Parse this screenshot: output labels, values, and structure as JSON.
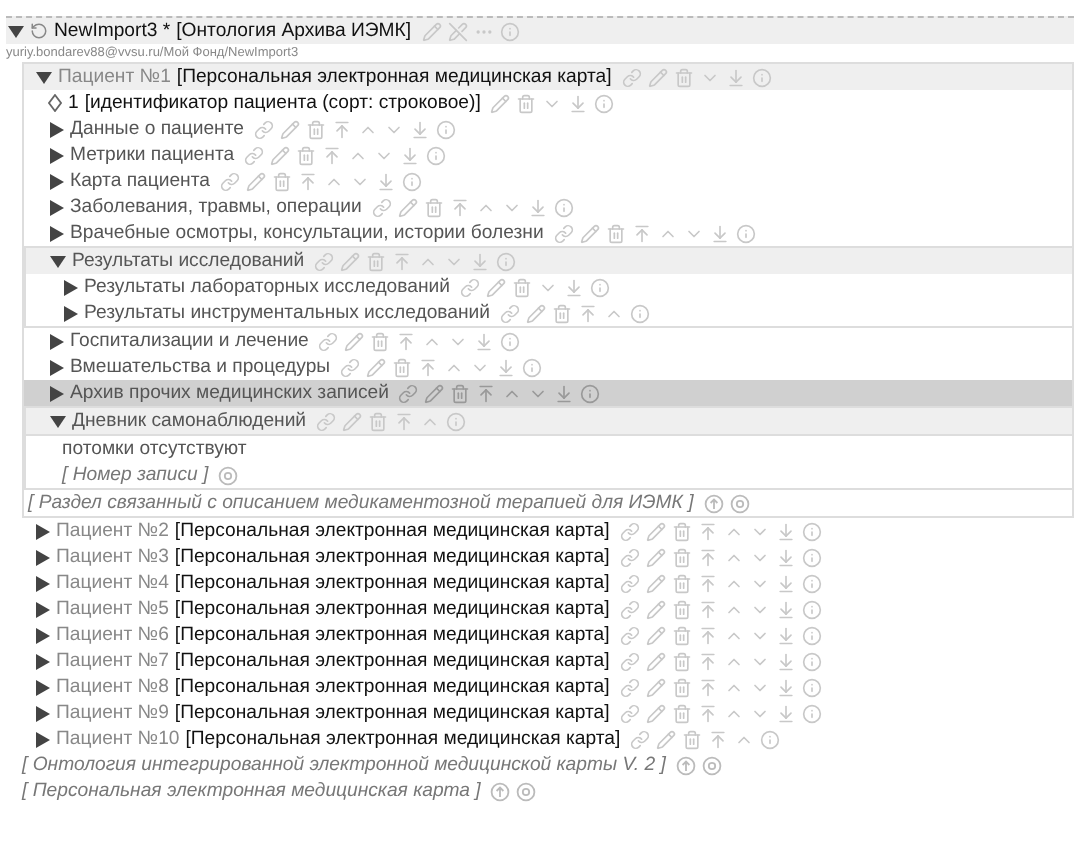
{
  "header": {
    "expanded": true,
    "title": "NewImport3 *",
    "type": "[Онтология Архива ИЭМК]",
    "path": "yuriy.bondarev88@vvsu.ru/Мой Фонд/NewImport3"
  },
  "tree": [
    {
      "kind": "node",
      "label": "Пациент №1",
      "type": "[Персональная электронная медицинская карта]",
      "expanded": true,
      "selected": false,
      "movable_up": false,
      "movable_down": true,
      "children": [
        {
          "kind": "attribute",
          "label": "1",
          "type": "[идентификатор пациента (сорт: строковое)]",
          "movable_up": false,
          "movable_down": true
        },
        {
          "kind": "node",
          "label": "Данные о пациенте",
          "expanded": false,
          "selected": false,
          "movable_up": true,
          "movable_down": true
        },
        {
          "kind": "node",
          "label": "Метрики пациента",
          "expanded": false,
          "selected": false,
          "movable_up": true,
          "movable_down": true
        },
        {
          "kind": "node",
          "label": "Карта пациента",
          "expanded": false,
          "selected": false,
          "movable_up": true,
          "movable_down": true
        },
        {
          "kind": "node",
          "label": "Заболевания, травмы, операции",
          "expanded": false,
          "selected": false,
          "movable_up": true,
          "movable_down": true
        },
        {
          "kind": "node",
          "label": "Врачебные осмотры, консультации, истории болезни",
          "expanded": false,
          "selected": false,
          "movable_up": true,
          "movable_down": true
        },
        {
          "kind": "node",
          "label": "Результаты исследований",
          "expanded": true,
          "selected": false,
          "movable_up": true,
          "movable_down": true,
          "children": [
            {
              "kind": "node",
              "label": "Результаты лабораторных исследований",
              "expanded": false,
              "selected": false,
              "movable_up": false,
              "movable_down": true
            },
            {
              "kind": "node",
              "label": "Результаты инструментальных исследований",
              "expanded": false,
              "selected": false,
              "movable_up": true,
              "movable_down": false
            }
          ]
        },
        {
          "kind": "node",
          "label": "Госпитализации и лечение",
          "expanded": false,
          "selected": false,
          "movable_up": true,
          "movable_down": true
        },
        {
          "kind": "node",
          "label": "Вмешательства и процедуры",
          "expanded": false,
          "selected": false,
          "movable_up": true,
          "movable_down": true
        },
        {
          "kind": "node",
          "label": "Архив прочих медицинских записей",
          "expanded": false,
          "selected": true,
          "movable_up": true,
          "movable_down": true
        },
        {
          "kind": "node",
          "label": "Дневник самонаблюдений",
          "expanded": true,
          "selected": false,
          "movable_up": true,
          "movable_down": false,
          "children": [
            {
              "kind": "note",
              "label": "потомки отсутствуют"
            },
            {
              "kind": "placeholder",
              "label": "[ Номер записи ]",
              "addable": false
            }
          ]
        },
        {
          "kind": "placeholder",
          "label": "[ Раздел связанный с описанием медикаментозной терапией для ИЭМК ]",
          "addable": true
        }
      ]
    },
    {
      "kind": "node",
      "label": "Пациент №2",
      "type": "[Персональная электронная медицинская карта]",
      "expanded": false,
      "selected": false,
      "movable_up": true,
      "movable_down": true
    },
    {
      "kind": "node",
      "label": "Пациент №3",
      "type": "[Персональная электронная медицинская карта]",
      "expanded": false,
      "selected": false,
      "movable_up": true,
      "movable_down": true
    },
    {
      "kind": "node",
      "label": "Пациент №4",
      "type": "[Персональная электронная медицинская карта]",
      "expanded": false,
      "selected": false,
      "movable_up": true,
      "movable_down": true
    },
    {
      "kind": "node",
      "label": "Пациент №5",
      "type": "[Персональная электронная медицинская карта]",
      "expanded": false,
      "selected": false,
      "movable_up": true,
      "movable_down": true
    },
    {
      "kind": "node",
      "label": "Пациент №6",
      "type": "[Персональная электронная медицинская карта]",
      "expanded": false,
      "selected": false,
      "movable_up": true,
      "movable_down": true
    },
    {
      "kind": "node",
      "label": "Пациент №7",
      "type": "[Персональная электронная медицинская карта]",
      "expanded": false,
      "selected": false,
      "movable_up": true,
      "movable_down": true
    },
    {
      "kind": "node",
      "label": "Пациент №8",
      "type": "[Персональная электронная медицинская карта]",
      "expanded": false,
      "selected": false,
      "movable_up": true,
      "movable_down": true
    },
    {
      "kind": "node",
      "label": "Пациент №9",
      "type": "[Персональная электронная медицинская карта]",
      "expanded": false,
      "selected": false,
      "movable_up": true,
      "movable_down": true
    },
    {
      "kind": "node",
      "label": "Пациент №10",
      "type": "[Персональная электронная медицинская карта]",
      "expanded": false,
      "selected": false,
      "movable_up": true,
      "movable_down": false
    },
    {
      "kind": "placeholder",
      "label": "[ Онтология интегрированной электронной медицинской карты V. 2 ]",
      "addable": true
    },
    {
      "kind": "placeholder",
      "label": "[ Персональная электронная медицинская карта ]",
      "addable": true
    }
  ]
}
